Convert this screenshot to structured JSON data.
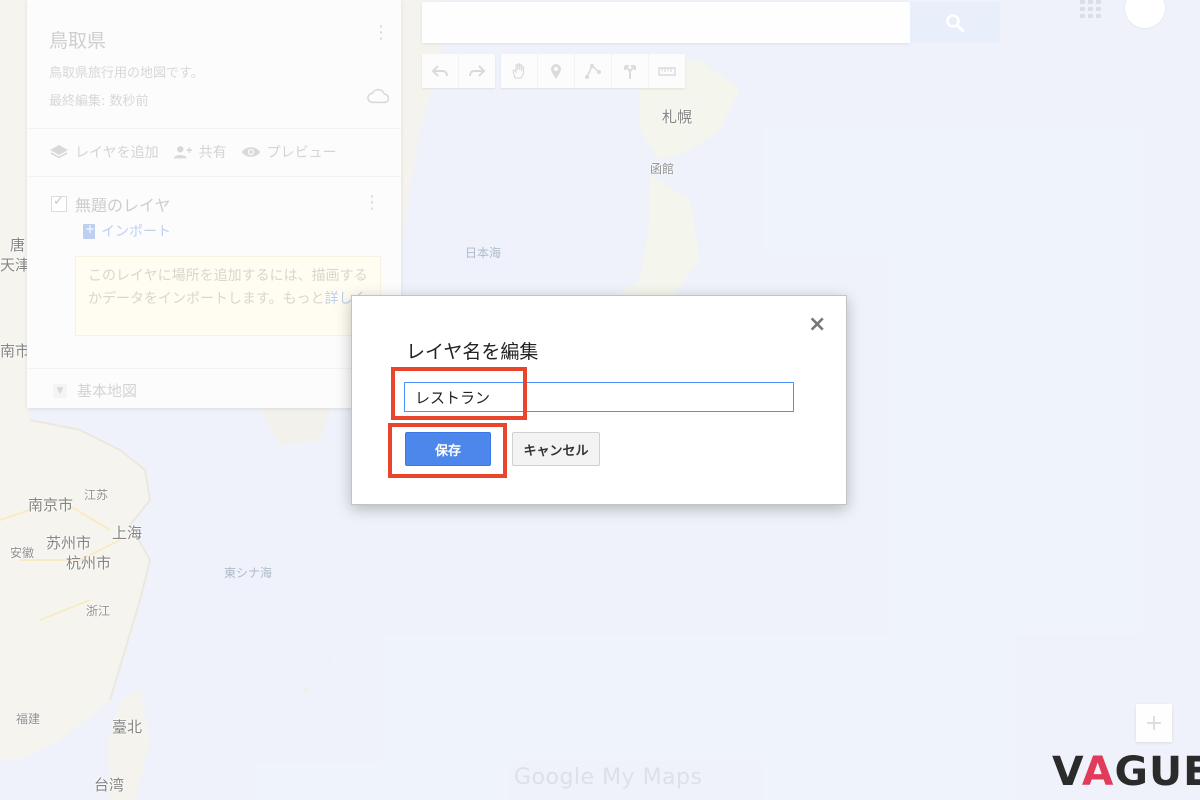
{
  "map": {
    "labels": {
      "sapporo": "札幌",
      "hakodate": "函館",
      "sea_of_japan": "日本海",
      "east_china_sea": "東シナ海",
      "tang": "唐",
      "tianjin": "天津",
      "nan": "南市",
      "nanjing": "南京市",
      "jiangsu": "江苏",
      "shanghai": "上海",
      "suzhou": "苏州市",
      "hangzhou": "杭州市",
      "anhui": "安徽",
      "zhejiang": "浙江",
      "fujian": "福建",
      "taipei": "臺北",
      "taiwan": "台湾"
    },
    "land_color": "#f2efe6",
    "water_color": "#e6ecf7"
  },
  "panel": {
    "title": "鳥取県",
    "description": "鳥取県旅行用の地図です。",
    "last_edited": "最終編集: 数秒前",
    "actions": {
      "add_layer": "レイヤを追加",
      "share": "共有",
      "preview": "プレビュー"
    },
    "layer": {
      "name": "無題のレイヤ",
      "import": "インポート",
      "hint_text": "このレイヤに場所を追加するには、描画するかデータをインポートします。も",
      "hint_tail": "っと",
      "hint_link": "詳しく"
    },
    "base_map": "基本地図"
  },
  "search": {
    "value": "",
    "placeholder": ""
  },
  "modal": {
    "title": "レイヤ名を編集",
    "input_value": "レストラン",
    "save_label": "保存",
    "cancel_label": "キャンセル",
    "close_symbol": "×"
  },
  "zoom": {
    "in_symbol": "+"
  },
  "watermark": {
    "google_my_maps": "Google My Maps",
    "vague_v": "V",
    "vague_a": "A",
    "vague_rest": "GUE"
  },
  "colors": {
    "primary_blue": "#4d87ec",
    "highlight_red": "#e8452c",
    "vague_accent": "#e23a5b"
  }
}
